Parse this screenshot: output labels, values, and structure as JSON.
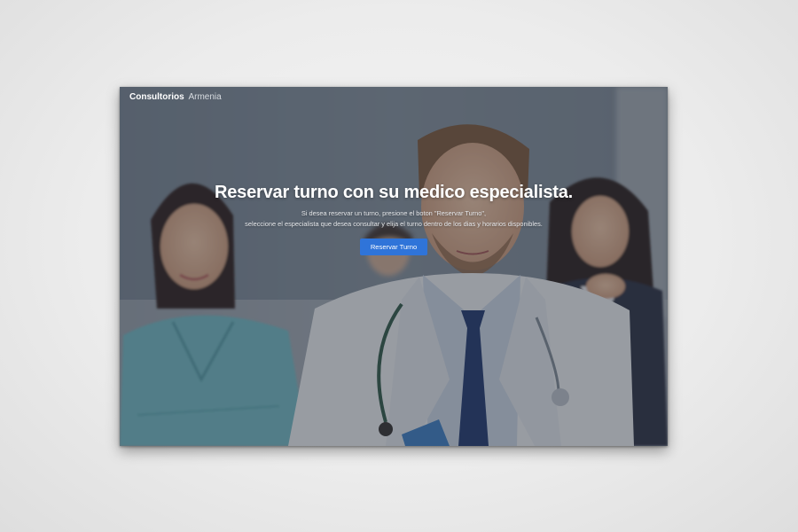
{
  "navbar": {
    "brand_strong": "Consultorios",
    "brand_light": "Armenia"
  },
  "hero": {
    "title": "Reservar turno con su medico especialista.",
    "description_line1": "Si desea reservar un turno, presione el boton \"Reservar Turno\",",
    "description_line2": "seleccione el especialista que desea consultar y elija el turno dentro de los dias y horarios disponibles.",
    "cta_label": "Reservar Turno"
  },
  "colors": {
    "accent": "#2f74d9",
    "overlay": "#3f4650",
    "scrub_green": "#6fb9c4",
    "coat_white": "#e9eef2"
  }
}
